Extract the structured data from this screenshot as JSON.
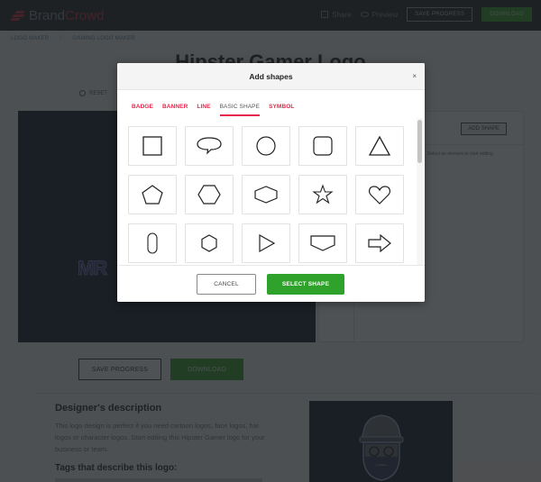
{
  "colors": {
    "accent_red": "#e8254a",
    "brand_red": "#c7263c",
    "green": "#2ea22a",
    "nav_bg": "#1c2128",
    "canvas_bg": "#111a2c"
  },
  "nav": {
    "brand_first": "Brand",
    "brand_second": "Crowd",
    "share_label": "Share",
    "preview_label": "Preview",
    "save_progress_label": "SAVE PROGRESS",
    "download_label": "DOWNLOAD"
  },
  "breadcrumb": {
    "items": [
      "LOGO MAKER",
      "GAMING LOGO MAKER"
    ],
    "separator": "/"
  },
  "page": {
    "title": "Hipster Gamer Logo",
    "reset_label": "RESET",
    "canvas_text": "MR",
    "side_panel": {
      "add_shape_label": "ADD SHAPE",
      "hint": "Select an element to start editing"
    },
    "save_progress_label": "SAVE PROGRESS",
    "download_label": "DOWNLOAD",
    "description_title": "Designer's description",
    "description_text": "This logo design is perfect if you need cartoon logos, face logos, hat logos or character logos. Start editing this Hipster Gamer logo for your business or team.",
    "tags_title": "Tags that describe this logo:"
  },
  "modal": {
    "title": "Add shapes",
    "close_label": "×",
    "tabs": [
      {
        "label": "BADGE",
        "active": false
      },
      {
        "label": "BANNER",
        "active": false
      },
      {
        "label": "LINE",
        "active": false
      },
      {
        "label": "BASIC SHAPE",
        "active": true
      },
      {
        "label": "SYMBOL",
        "active": false
      }
    ],
    "shapes": [
      "square",
      "speech-bubble",
      "circle",
      "rounded-square",
      "triangle",
      "pentagon",
      "hexagon",
      "wide-hexagon",
      "star",
      "heart",
      "pill",
      "small-hexagon",
      "play-triangle",
      "home-plate",
      "arrow-right"
    ],
    "cancel_label": "CANCEL",
    "select_label": "SELECT SHAPE"
  }
}
